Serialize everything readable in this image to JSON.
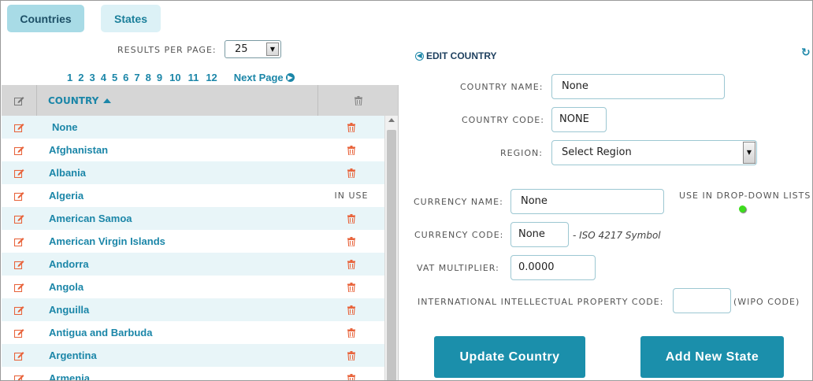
{
  "tabs": {
    "countries": "Countries",
    "states": "States"
  },
  "results_per_page": {
    "label": "RESULTS PER PAGE:",
    "value": "25"
  },
  "pagination": {
    "pages": [
      "1",
      "2",
      "3",
      "4",
      "5",
      "6",
      "7",
      "8",
      "9",
      "10",
      "11",
      "12"
    ],
    "next_label": "Next Page"
  },
  "table": {
    "header": {
      "country": "COUNTRY",
      "sort": "ascending"
    },
    "rows": [
      {
        "name": "None",
        "status": ""
      },
      {
        "name": "Afghanistan",
        "status": ""
      },
      {
        "name": "Albania",
        "status": ""
      },
      {
        "name": "Algeria",
        "status": "IN USE"
      },
      {
        "name": "American Samoa",
        "status": ""
      },
      {
        "name": "American Virgin Islands",
        "status": ""
      },
      {
        "name": "Andorra",
        "status": ""
      },
      {
        "name": "Angola",
        "status": ""
      },
      {
        "name": "Anguilla",
        "status": ""
      },
      {
        "name": "Antigua and Barbuda",
        "status": ""
      },
      {
        "name": "Argentina",
        "status": ""
      },
      {
        "name": "Armenia",
        "status": ""
      }
    ]
  },
  "edit": {
    "title": "EDIT COUNTRY",
    "country_name_label": "COUNTRY NAME:",
    "country_name_value": "None",
    "country_code_label": "COUNTRY CODE:",
    "country_code_value": "NONE",
    "region_label": "REGION:",
    "region_value": "Select Region",
    "currency_name_label": "CURRENCY NAME:",
    "currency_name_value": "None",
    "currency_code_label": "CURRENCY CODE:",
    "currency_code_value": "None",
    "iso_note": "- ISO 4217 Symbol",
    "vat_label": "VAT MULTIPLIER:",
    "vat_value": "0.0000",
    "ipc_label": "INTERNATIONAL INTELLECTUAL PROPERTY CODE:",
    "ipc_value": "",
    "wipo_note": "(WIPO CODE)",
    "dropdown_label": "USE IN DROP-DOWN LISTS",
    "dropdown_enabled": true,
    "update_button": "Update Country",
    "add_state_button": "Add New State"
  },
  "colors": {
    "accent": "#1b8fab",
    "link": "#1b86a8",
    "delete": "#e8643c",
    "toggle_on": "#3ddc1d"
  }
}
